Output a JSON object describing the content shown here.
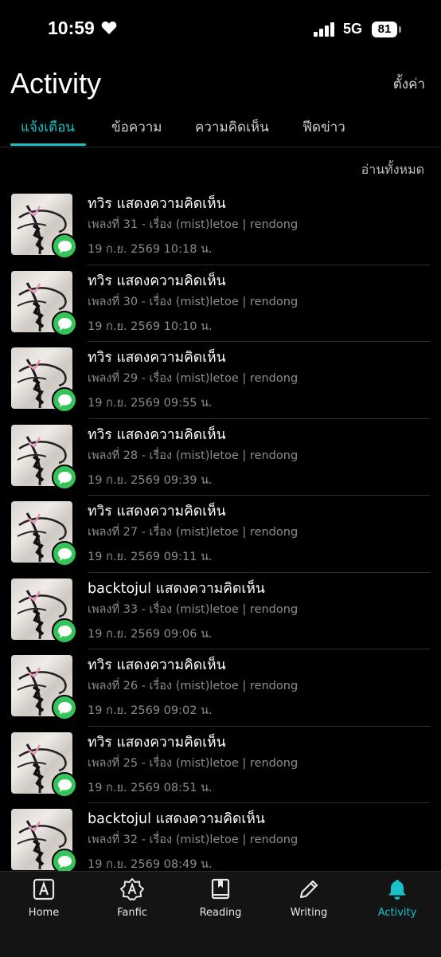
{
  "status_bar": {
    "time": "10:59",
    "network": "5G",
    "battery": "81"
  },
  "header": {
    "title": "Activity",
    "settings_label": "ตั้งค่า"
  },
  "tabs": [
    {
      "label": "แจ้งเตือน",
      "active": true
    },
    {
      "label": "ข้อความ",
      "active": false
    },
    {
      "label": "ความคิดเห็น",
      "active": false
    },
    {
      "label": "ฟีดข่าว",
      "active": false
    }
  ],
  "read_all_label": "อ่านทั้งหมด",
  "notifications": [
    {
      "title": "ทวิร แสดงความคิดเห็น",
      "subtitle": "เพลงที่ 31 -  เรื่อง (mist)letoe | rendong",
      "date": "19 ก.ย. 2569 10:18 น."
    },
    {
      "title": "ทวิร แสดงความคิดเห็น",
      "subtitle": "เพลงที่ 30 -  เรื่อง (mist)letoe | rendong",
      "date": "19 ก.ย. 2569 10:10 น."
    },
    {
      "title": "ทวิร แสดงความคิดเห็น",
      "subtitle": "เพลงที่ 29 -  เรื่อง (mist)letoe | rendong",
      "date": "19 ก.ย. 2569 09:55 น."
    },
    {
      "title": "ทวิร แสดงความคิดเห็น",
      "subtitle": "เพลงที่ 28 -  เรื่อง (mist)letoe | rendong",
      "date": "19 ก.ย. 2569 09:39 น."
    },
    {
      "title": "ทวิร แสดงความคิดเห็น",
      "subtitle": "เพลงที่ 27 -  เรื่อง (mist)letoe | rendong",
      "date": "19 ก.ย. 2569 09:11 น."
    },
    {
      "title": "backtojul แสดงความคิดเห็น",
      "subtitle": "เพลงที่ 33 -  เรื่อง (mist)letoe | rendong",
      "date": "19 ก.ย. 2569 09:06 น."
    },
    {
      "title": "ทวิร แสดงความคิดเห็น",
      "subtitle": "เพลงที่ 26 -  เรื่อง (mist)letoe | rendong",
      "date": "19 ก.ย. 2569 09:02 น."
    },
    {
      "title": "ทวิร แสดงความคิดเห็น",
      "subtitle": "เพลงที่ 25 -  เรื่อง (mist)letoe | rendong",
      "date": "19 ก.ย. 2569 08:51 น."
    },
    {
      "title": "backtojul แสดงความคิดเห็น",
      "subtitle": "เพลงที่ 32 -  เรื่อง (mist)letoe | rendong",
      "date": "19 ก.ย. 2569 08:49 น."
    }
  ],
  "bottom_nav": [
    {
      "label": "Home",
      "icon": "home-icon",
      "active": false
    },
    {
      "label": "Fanfic",
      "icon": "fanfic-icon",
      "active": false
    },
    {
      "label": "Reading",
      "icon": "book-icon",
      "active": false
    },
    {
      "label": "Writing",
      "icon": "pencil-icon",
      "active": false
    },
    {
      "label": "Activity",
      "icon": "bell-icon",
      "active": true
    }
  ],
  "colors": {
    "accent": "#17c3c8",
    "badge": "#35c45a",
    "background": "#000000"
  }
}
